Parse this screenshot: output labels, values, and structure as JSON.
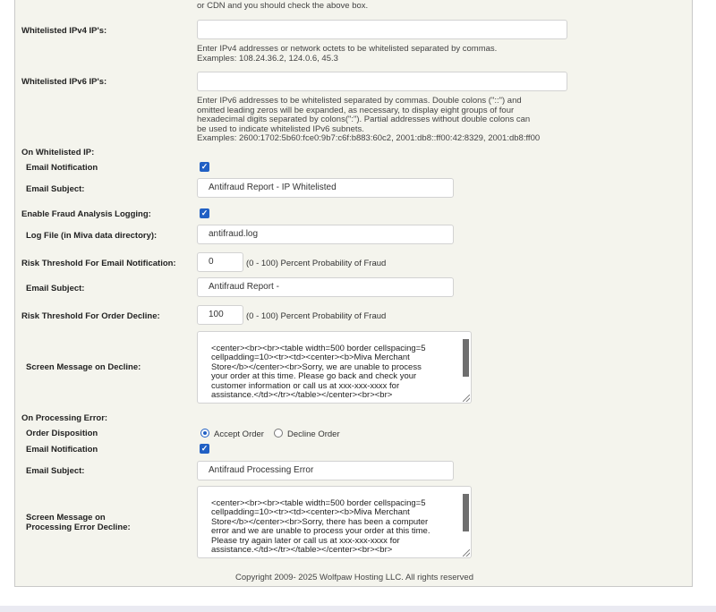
{
  "intro_text": [
    "or CDN and you should check the above box."
  ],
  "whitelist_ipv4": {
    "label": "Whitelisted IPv4 IP's:",
    "value": "",
    "help": [
      "Enter IPv4 addresses or network octets to be whitelisted separated by commas.",
      "Examples: 108.24.36.2, 124.0.6, 45.3"
    ]
  },
  "whitelist_ipv6": {
    "label": "Whitelisted IPv6 IP's:",
    "value": "",
    "help": [
      "Enter IPv6 addresses to be whitelisted separated by commas. Double colons (\"::\") and",
      "omitted leading zeros will be expanded, as necessary, to display eight groups of four",
      "hexadecimal digits separated by colons(\":\"). Partial addresses without double colons can",
      "be used to indicate whitelisted IPv6 subnets.",
      "Examples: 2600:1702:5b60:fce0:9b7:c6f:b883:60c2, 2001:db8::ff00:42:8329, 2001:db8:ff00"
    ]
  },
  "on_whitelisted": {
    "heading": "On Whitelisted IP:",
    "email_notification_label": "Email Notification",
    "email_notification_checked": true,
    "email_subject_label": "Email Subject:",
    "email_subject_value": "Antifraud Report - IP Whitelisted"
  },
  "logging": {
    "enable_label": "Enable Fraud Analysis Logging:",
    "enabled": true,
    "log_file_label": "Log File (in Miva data directory):",
    "log_file_value": "antifraud.log"
  },
  "risk_email": {
    "label": "Risk Threshold For Email Notification:",
    "value": "0",
    "unit": "(0 - 100) Percent Probability of Fraud",
    "subject_label": "Email Subject:",
    "subject_value": "Antifraud Report -"
  },
  "risk_decline": {
    "label": "Risk Threshold For Order Decline:",
    "value": "100",
    "unit": "(0 - 100) Percent Probability of Fraud",
    "screen_message_label": "Screen Message on Decline:",
    "screen_message_value": "<center><br><br><table width=500 border cellspacing=5\ncellpadding=10><tr><td><center><b>Miva Merchant\nStore</b></center><br>Sorry, we are unable to process\nyour order at this time. Please go back and check your\ncustomer information or call us at xxx-xxx-xxxx for\nassistance.</td></tr></table></center><br><br>"
  },
  "on_error": {
    "heading": "On Processing Error:",
    "disposition_label": "Order Disposition",
    "options": [
      "Accept Order",
      "Decline Order"
    ],
    "selected": "Accept Order",
    "email_notification_label": "Email Notification",
    "email_notification_checked": true,
    "email_subject_label": "Email Subject:",
    "email_subject_value": "Antifraud Processing Error",
    "screen_message_label_1": "Screen Message on",
    "screen_message_label_2": "Processing Error Decline:",
    "screen_message_value": "<center><br><br><table width=500 border cellspacing=5\ncellpadding=10><tr><td><center><b>Miva Merchant\nStore</b></center><br>Sorry, there has been a computer\nerror and we are unable to process your order at this time.\nPlease try again later or call us at xxx-xxx-xxxx for\nassistance.</td></tr></table></center><br><br>"
  },
  "footer": "Copyright 2009- 2025 Wolfpaw Hosting LLC. All rights reserved",
  "colors": {
    "panel_bg": "#f4f4ed",
    "accent": "#2160c4"
  }
}
